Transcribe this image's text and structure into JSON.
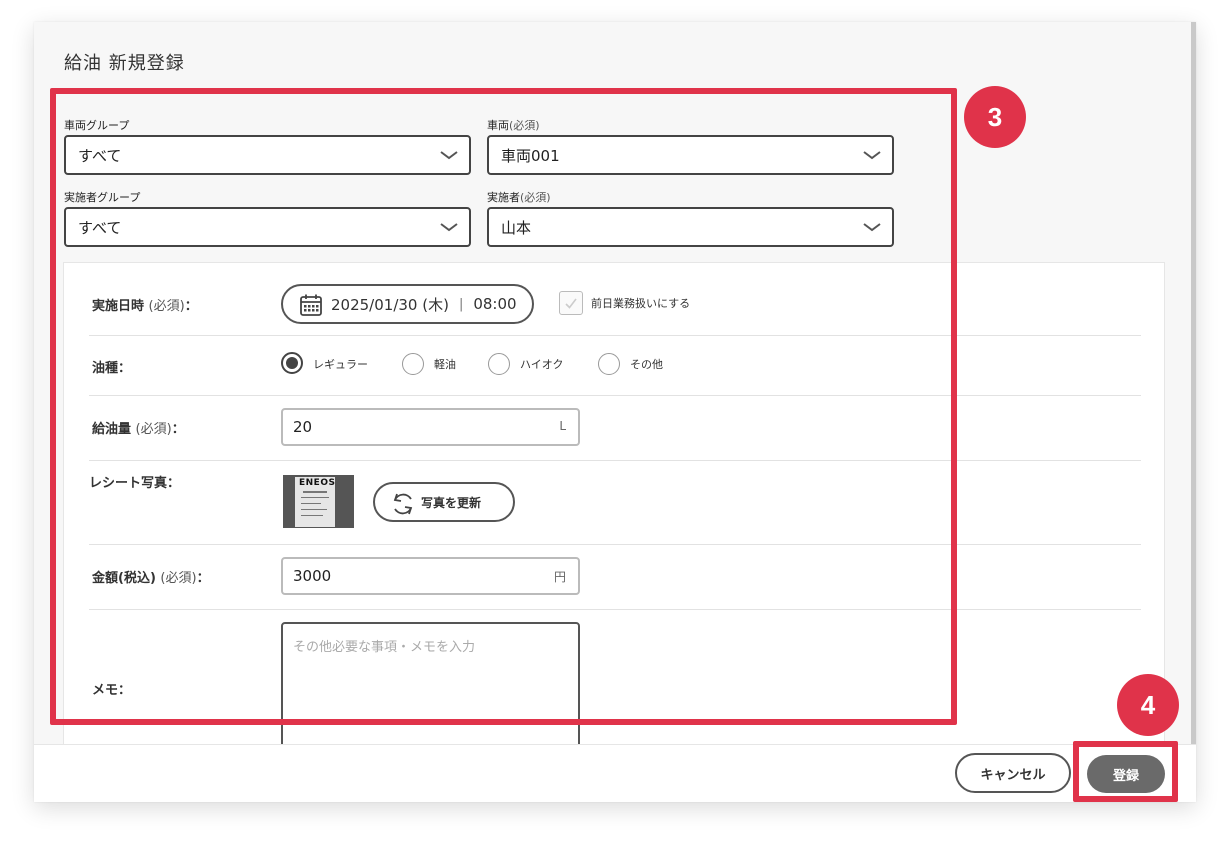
{
  "modal": {
    "title": "給油 新規登録"
  },
  "filters": {
    "vehicle_group": {
      "label": "車両グループ",
      "value": "すべて"
    },
    "vehicle": {
      "label": "車両",
      "required": "(必須)",
      "value": "車両001"
    },
    "operator_group": {
      "label": "実施者グループ",
      "value": "すべて"
    },
    "operator": {
      "label": "実施者",
      "required": "(必須)",
      "value": "山本"
    }
  },
  "form": {
    "datetime": {
      "label": "実施日時",
      "required": "(必須)",
      "colon": "：",
      "date": "2025/01/30 (木)",
      "separator": "|",
      "time": "08:00",
      "previous_day_label": "前日業務扱いにする"
    },
    "fuel_type": {
      "label": "油種",
      "colon": "：",
      "options": [
        "レギュラー",
        "軽油",
        "ハイオク",
        "その他"
      ],
      "selected": "レギュラー"
    },
    "amount": {
      "label": "給油量",
      "required": "(必須)",
      "colon": "：",
      "value": "20",
      "unit": "L"
    },
    "receipt": {
      "label": "レシート写真",
      "colon": "：",
      "thumb_text": "ENEOS",
      "update_button": "写真を更新"
    },
    "price": {
      "label": "金額(税込)",
      "required": "(必須)",
      "colon": "：",
      "value": "3000",
      "unit": "円"
    },
    "memo": {
      "label": "メモ",
      "colon": "：",
      "placeholder": "その他必要な事項・メモを入力"
    }
  },
  "footer": {
    "cancel_label": "キャンセル",
    "submit_label": "登録"
  },
  "annotations": {
    "badge_3": "3",
    "badge_4": "4",
    "color": "#e0334a"
  }
}
